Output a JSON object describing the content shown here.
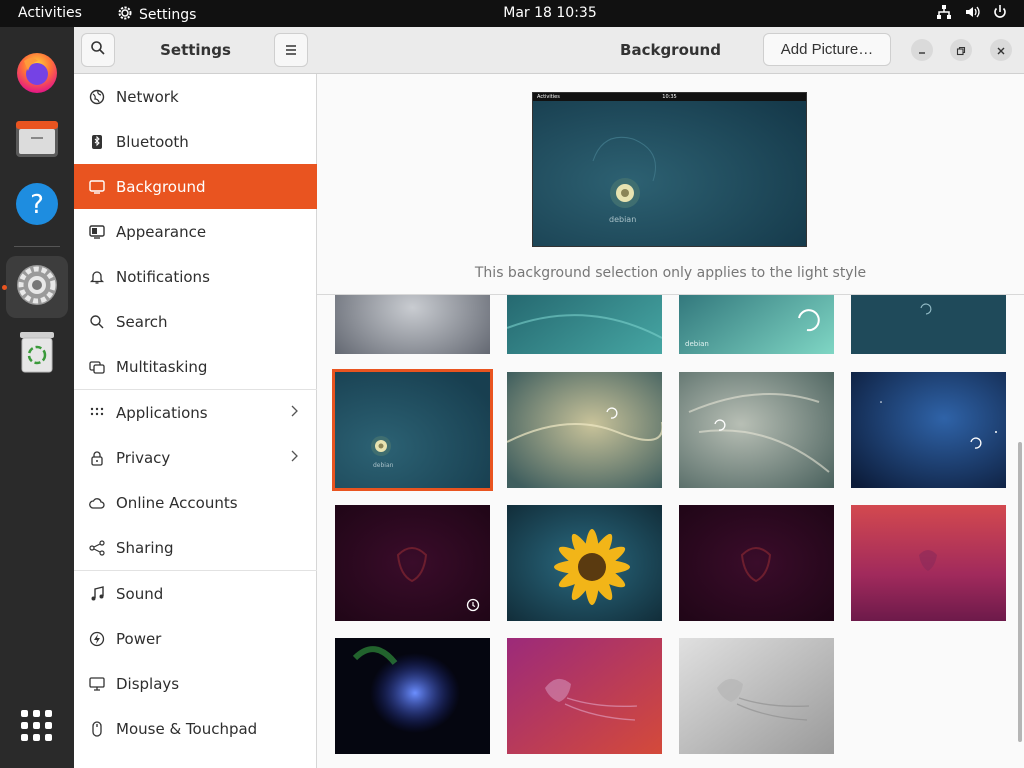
{
  "topbar": {
    "activities": "Activities",
    "app_name": "Settings",
    "clock": "Mar 18  10:35"
  },
  "dock": {
    "items": [
      "firefox-icon",
      "files-icon",
      "help-icon",
      "settings-icon",
      "trash-icon"
    ],
    "apps_grid": "show-apps-icon"
  },
  "sidebar": {
    "title": "Settings",
    "items": [
      {
        "label": "Network",
        "icon": "network-icon"
      },
      {
        "label": "Bluetooth",
        "icon": "bluetooth-icon"
      },
      {
        "label": "Background",
        "icon": "background-icon",
        "selected": true
      },
      {
        "label": "Appearance",
        "icon": "appearance-icon"
      },
      {
        "label": "Notifications",
        "icon": "bell-icon"
      },
      {
        "label": "Search",
        "icon": "search-icon"
      },
      {
        "label": "Multitasking",
        "icon": "multitasking-icon"
      },
      {
        "label": "Applications",
        "icon": "apps-icon",
        "chevron": true
      },
      {
        "label": "Privacy",
        "icon": "lock-icon",
        "chevron": true
      },
      {
        "label": "Online Accounts",
        "icon": "cloud-icon"
      },
      {
        "label": "Sharing",
        "icon": "share-icon"
      },
      {
        "label": "Sound",
        "icon": "music-note-icon"
      },
      {
        "label": "Power",
        "icon": "power-icon"
      },
      {
        "label": "Displays",
        "icon": "display-icon"
      },
      {
        "label": "Mouse & Touchpad",
        "icon": "mouse-icon"
      }
    ]
  },
  "main": {
    "title": "Background",
    "add_button": "Add Picture…",
    "preview": {
      "bar_left": "Activities",
      "bar_center": "10:35",
      "logo_text": "debian"
    },
    "note": "This background selection only applies to the light style"
  },
  "wallpapers": [
    {
      "name": "gray-swirl",
      "style": "gray"
    },
    {
      "name": "teal-waves",
      "style": "teal"
    },
    {
      "name": "debian-swirl-teal",
      "style": "teal-debian",
      "label": "debian"
    },
    {
      "name": "dark-blue-swirl",
      "style": "darkteal"
    },
    {
      "name": "debian-logo-dark-teal",
      "style": "debian-selected",
      "label": "debian",
      "selected": true
    },
    {
      "name": "gold-swirl-teal",
      "style": "goldteal"
    },
    {
      "name": "gray-teal-swirl",
      "style": "grayteal"
    },
    {
      "name": "starry-blue",
      "style": "starblue"
    },
    {
      "name": "jammy-dark-purple-clock",
      "style": "darkpurple",
      "timed": true
    },
    {
      "name": "yellow-flower",
      "style": "flower"
    },
    {
      "name": "jammy-dark-purple",
      "style": "darkpurple"
    },
    {
      "name": "jammy-pink-gradient",
      "style": "pinkgrad"
    },
    {
      "name": "blue-jellyfish",
      "style": "bluejelly"
    },
    {
      "name": "pink-jellyfish",
      "style": "pinkjelly"
    },
    {
      "name": "gray-jellyfish",
      "style": "grayjelly"
    }
  ],
  "colors": {
    "accent": "#e95420",
    "dock": "#2a2a2a",
    "topbar": "#111111"
  }
}
